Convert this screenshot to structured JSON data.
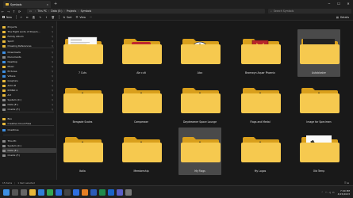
{
  "window": {
    "tab_title": "Symbols",
    "new_tab": "+",
    "minimize": "─",
    "maximize": "☐",
    "close": "✕"
  },
  "nav": {
    "back": "←",
    "forward": "→",
    "up": "↑",
    "refresh": "⟳",
    "breadcrumb": [
      "This PC",
      "Data (E:)",
      "Projects",
      "Symbols"
    ],
    "search_placeholder": "Search Symbols"
  },
  "commands": {
    "new": "New",
    "sort": "Sort",
    "view": "View",
    "more": "···",
    "details": "Details"
  },
  "sidebar": {
    "items": [
      {
        "label": "Projects",
        "pinned": true,
        "color": "yellow"
      },
      {
        "label": "The Eight Lords of Dream...",
        "pinned": true,
        "color": "yellow"
      },
      {
        "label": "Family Album",
        "pinned": true,
        "color": "yellow"
      },
      {
        "label": "Spirit",
        "pinned": true,
        "color": "yellow"
      },
      {
        "label": "Drawing References",
        "pinned": true,
        "color": "yellow"
      },
      {
        "label": "Downloads",
        "pinned": true,
        "color": "blue"
      },
      {
        "label": "Documents",
        "pinned": true,
        "color": "grey"
      },
      {
        "label": "Desktop",
        "pinned": true,
        "color": "blue"
      },
      {
        "label": "Music",
        "pinned": true,
        "color": "yellow"
      },
      {
        "label": "Pictures",
        "pinned": true,
        "color": "blue"
      },
      {
        "label": "Videos",
        "pinned": true,
        "color": "blue"
      },
      {
        "label": "Graphics",
        "pinned": true,
        "color": "yellow"
      },
      {
        "label": "Anto-Pi",
        "pinned": true,
        "color": "yellow"
      },
      {
        "label": "RHINO 4",
        "pinned": true,
        "color": "yellow"
      },
      {
        "label": "Art",
        "pinned": true,
        "color": "yellow"
      },
      {
        "label": "System (C:)",
        "pinned": true,
        "color": "grey"
      },
      {
        "label": "Data (E:)",
        "pinned": true,
        "color": "grey"
      },
      {
        "label": "Onetix (F:)",
        "pinned": true,
        "color": "grey"
      },
      {
        "label": "Box",
        "pinned": false,
        "color": "yellow"
      },
      {
        "label": "Creative Cloud Files",
        "pinned": false,
        "color": "yellow"
      },
      {
        "label": "OneDrive",
        "pinned": false,
        "color": "blue"
      },
      {
        "label": "This PC",
        "pinned": false,
        "color": "grey"
      },
      {
        "label": "System (C:)",
        "pinned": false,
        "color": "grey"
      },
      {
        "label": "Data (E:)",
        "pinned": false,
        "color": "grey",
        "active": true
      },
      {
        "label": "Onetix (F:)",
        "pinned": false,
        "color": "grey"
      }
    ]
  },
  "folders": [
    {
      "name": "7 Cuts",
      "thumb": "doc"
    },
    {
      "name": "Ale cult",
      "thumb": "cub"
    },
    {
      "name": "Aloc",
      "thumb": "triangle"
    },
    {
      "name": "Bromwyn Aquar Phoenix",
      "thumb": "shield"
    },
    {
      "name": "Autoblaster",
      "thumb": "dark",
      "selected": true
    },
    {
      "name": "Bengade Scales",
      "thumb": "eye"
    },
    {
      "name": "Camperawr",
      "thumb": "eye"
    },
    {
      "name": "Daydreamer Space Lounge",
      "thumb": "eye"
    },
    {
      "name": "Flags and Medal",
      "thumb": "eye"
    },
    {
      "name": "Image for Specimen",
      "thumb": "eye"
    },
    {
      "name": "Italia",
      "thumb": "eye"
    },
    {
      "name": "Membership",
      "thumb": "eye"
    },
    {
      "name": "My Flags",
      "thumb": "eye",
      "selected": true
    },
    {
      "name": "My Logos",
      "thumb": "eye"
    },
    {
      "name": "Old Temp",
      "thumb": "guitar"
    }
  ],
  "status": {
    "count": "15 items",
    "selection": "1 item selected",
    "views": "☰ ⊞"
  },
  "taskbar": {
    "icons": [
      "start",
      "search",
      "task-view",
      "explorer",
      "edge",
      "chrome",
      "mail",
      "store",
      "photoshop",
      "illustrator",
      "word",
      "excel",
      "outlook",
      "teams",
      "settings"
    ],
    "time": "7:00 PM",
    "date": "4/15/2023"
  }
}
